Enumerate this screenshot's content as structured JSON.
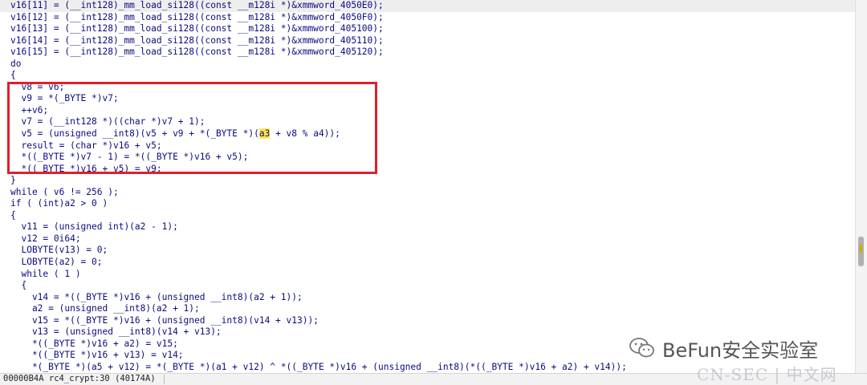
{
  "code_lines": [
    "v16[11] = (__int128)_mm_load_si128((const __m128i *)&xmmword_4050E0);",
    "v16[12] = (__int128)_mm_load_si128((const __m128i *)&xmmword_4050F0);",
    "v16[13] = (__int128)_mm_load_si128((const __m128i *)&xmmword_405100);",
    "v16[14] = (__int128)_mm_load_si128((const __m128i *)&xmmword_405110);",
    "v16[15] = (__int128)_mm_load_si128((const __m128i *)&xmmword_405120);",
    "do",
    "{",
    "  v8 = v6;",
    "  v9 = *(_BYTE *)v7;",
    "  ++v6;",
    "  v7 = (__int128 *)((char *)v7 + 1);",
    "  v5 = (unsigned __int8)(v5 + v9 + *(_BYTE *)(a3 + v8 % a4));",
    "  result = (char *)v16 + v5;",
    "  *((_BYTE *)v7 - 1) = *((_BYTE *)v16 + v5);",
    "  *((_BYTE *)v16 + v5) = v9;",
    "}",
    "while ( v6 != 256 );",
    "if ( (int)a2 > 0 )",
    "{",
    "  v11 = (unsigned int)(a2 - 1);",
    "  v12 = 0i64;",
    "  LOBYTE(v13) = 0;",
    "  LOBYTE(a2) = 0;",
    "  while ( 1 )",
    "  {",
    "    v14 = *((_BYTE *)v16 + (unsigned __int8)(a2 + 1));",
    "    a2 = (unsigned __int8)(a2 + 1);",
    "    v15 = *((_BYTE *)v16 + (unsigned __int8)(v14 + v13));",
    "    v13 = (unsigned __int8)(v14 + v13);",
    "    *((_BYTE *)v16 + a2) = v15;",
    "    *((_BYTE *)v16 + v13) = v14;",
    "    *(_BYTE *)(a5 + v12) = *(_BYTE *)(a1 + v12) ^ *((_BYTE *)v16 + (unsigned __int8)(*((_BYTE *)v16 + a2) + v14));"
  ],
  "highlighted_token": "a3",
  "status_bar": "00000B4A rc4_crypt:30 (40174A)",
  "watermark": {
    "brand": "BeFun安全实验室",
    "site": "CN-SEC | 中文网",
    "icon": "wechat-icon"
  },
  "colors": {
    "box_border": "#e0202a",
    "highlight": "#ffe84a",
    "code_text": "#0b0b80"
  }
}
